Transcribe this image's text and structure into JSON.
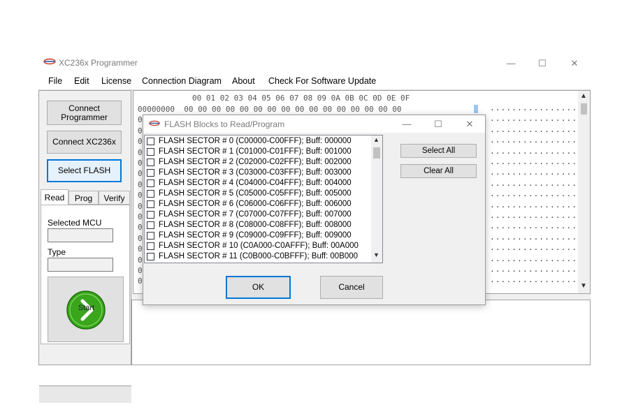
{
  "window": {
    "title": "XC236x Programmer",
    "icon": "app-logo-icon",
    "controls": {
      "minimize": "—",
      "maximize": "☐",
      "close": "✕"
    }
  },
  "menu": [
    "File",
    "Edit",
    "License",
    "Connection Diagram",
    "About",
    "Check For Software Update"
  ],
  "sidebar": {
    "connect_programmer": "Connect Programmer",
    "connect_xc236x": "Connect XC236x",
    "select_flash": "Select FLASH",
    "tabs": [
      "Read",
      "Prog",
      "Verify"
    ],
    "selected_mcu_label": "Selected MCU",
    "selected_mcu_value": "",
    "type_label": "Type",
    "type_value": "",
    "start_label": "Start",
    "start_icon": "chevron-right-icon"
  },
  "hex_view": {
    "header": "00 01 02 03 04 05 06 07 08 09 0A 0B 0C 0D 0E 0F",
    "first_row": "00000000  00 00 00 00 00 00 00 00 00 00 00 00 00 00 00 00",
    "row_prefix": "0",
    "ascii": "................"
  },
  "dialog": {
    "title": "FLASH Blocks to Read/Program",
    "sectors": [
      "FLASH SECTOR # 0 (C00000-C00FFF); Buff: 000000",
      "FLASH SECTOR # 1 (C01000-C01FFF); Buff: 001000",
      "FLASH SECTOR # 2 (C02000-C02FFF); Buff: 002000",
      "FLASH SECTOR # 3 (C03000-C03FFF); Buff: 003000",
      "FLASH SECTOR # 4 (C04000-C04FFF); Buff: 004000",
      "FLASH SECTOR # 5 (C05000-C05FFF); Buff: 005000",
      "FLASH SECTOR # 6 (C06000-C06FFF); Buff: 006000",
      "FLASH SECTOR # 7 (C07000-C07FFF); Buff: 007000",
      "FLASH SECTOR # 8 (C08000-C08FFF); Buff: 008000",
      "FLASH SECTOR # 9 (C09000-C09FFF); Buff: 009000",
      "FLASH SECTOR # 10 (C0A000-C0AFFF); Buff: 00A000",
      "FLASH SECTOR # 11 (C0B000-C0BFFF); Buff: 00B000"
    ],
    "select_all": "Select All",
    "clear_all": "Clear All",
    "ok": "OK",
    "cancel": "Cancel"
  },
  "colors": {
    "accent": "#0078d7",
    "start_green": "#3aa61c"
  }
}
